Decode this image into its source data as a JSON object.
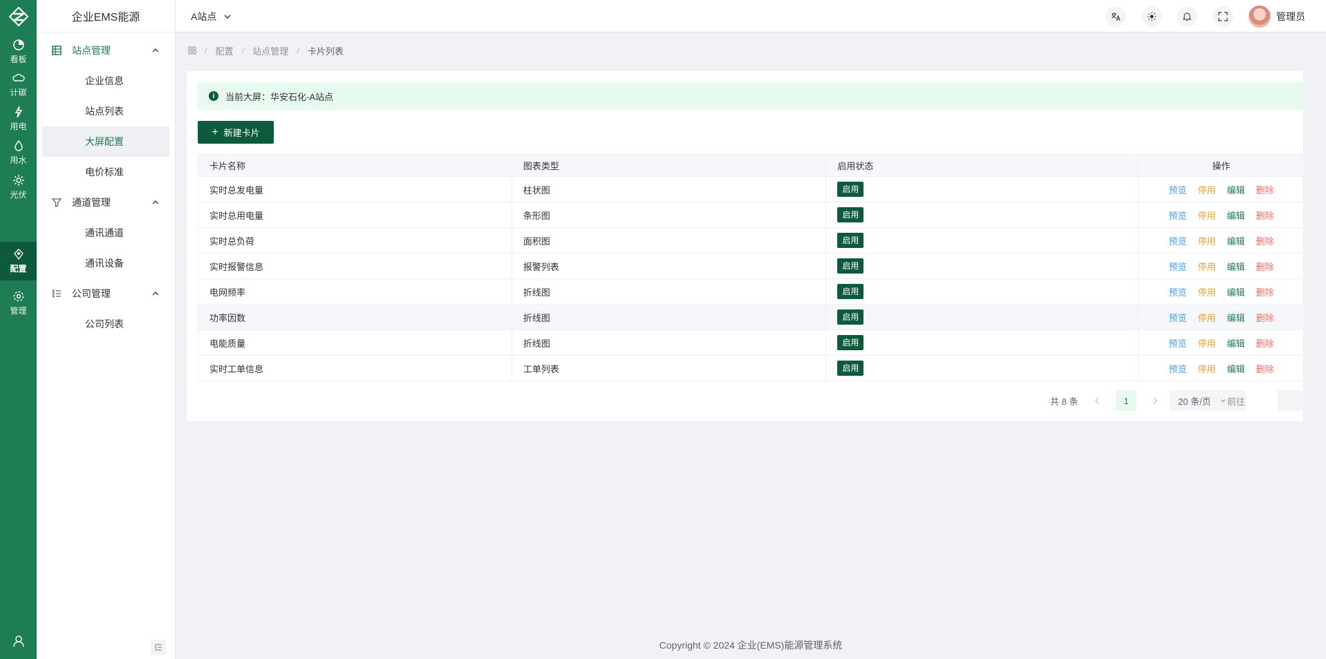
{
  "rail": {
    "items": [
      {
        "label": "看板",
        "icon": "dashboard-icon"
      },
      {
        "label": "计碳",
        "icon": "carbon-cloud-icon"
      },
      {
        "label": "用电",
        "icon": "electricity-icon"
      },
      {
        "label": "用水",
        "icon": "water-drop-icon"
      },
      {
        "label": "光伏",
        "icon": "sun-icon"
      },
      {
        "label": "配置",
        "icon": "config-icon",
        "active": true
      },
      {
        "label": "管理",
        "icon": "gear-icon"
      }
    ]
  },
  "sidebar": {
    "brand": "企业EMS能源",
    "groups": [
      {
        "label": "站点管理",
        "icon": "list-icon",
        "items": [
          "企业信息",
          "站点列表",
          "大屏配置",
          "电价标准"
        ],
        "active_item": "大屏配置"
      },
      {
        "label": "通道管理",
        "icon": "filter-icon",
        "items": [
          "通讯通道",
          "通讯设备"
        ]
      },
      {
        "label": "公司管理",
        "icon": "tree-list-icon",
        "items": [
          "公司列表"
        ]
      }
    ]
  },
  "header": {
    "site": "A站点",
    "user": "管理员"
  },
  "breadcrumb": {
    "items": [
      "配置",
      "站点管理",
      "卡片列表"
    ]
  },
  "alert": {
    "text": "当前大屏：华安石化-A站点"
  },
  "toolbar": {
    "new_label": "新建卡片"
  },
  "table": {
    "columns": [
      "卡片名称",
      "图表类型",
      "启用状态",
      "操作"
    ],
    "rows": [
      {
        "name": "实时总发电量",
        "type": "柱状图",
        "status": "启用"
      },
      {
        "name": "实时总用电量",
        "type": "条形图",
        "status": "启用"
      },
      {
        "name": "实时总负荷",
        "type": "面积图",
        "status": "启用"
      },
      {
        "name": "实时报警信息",
        "type": "报警列表",
        "status": "启用"
      },
      {
        "name": "电网频率",
        "type": "折线图",
        "status": "启用"
      },
      {
        "name": "功率因数",
        "type": "折线图",
        "status": "启用"
      },
      {
        "name": "电能质量",
        "type": "折线图",
        "status": "启用"
      },
      {
        "name": "实时工单信息",
        "type": "工单列表",
        "status": "启用"
      }
    ],
    "actions": {
      "preview": "预览",
      "stop": "停用",
      "edit": "编辑",
      "delete": "删除"
    }
  },
  "pagination": {
    "total": "共 8 条",
    "current_page": "1",
    "page_size": "20 条/页",
    "goto_label": "前往"
  },
  "footer": {
    "text": "Copyright © 2024 企业(EMS)能源管理系统"
  },
  "colors": {
    "rail_bg": "#1e7d55",
    "primary": "#0e5a3c",
    "alert_bg": "#e8faf0"
  }
}
